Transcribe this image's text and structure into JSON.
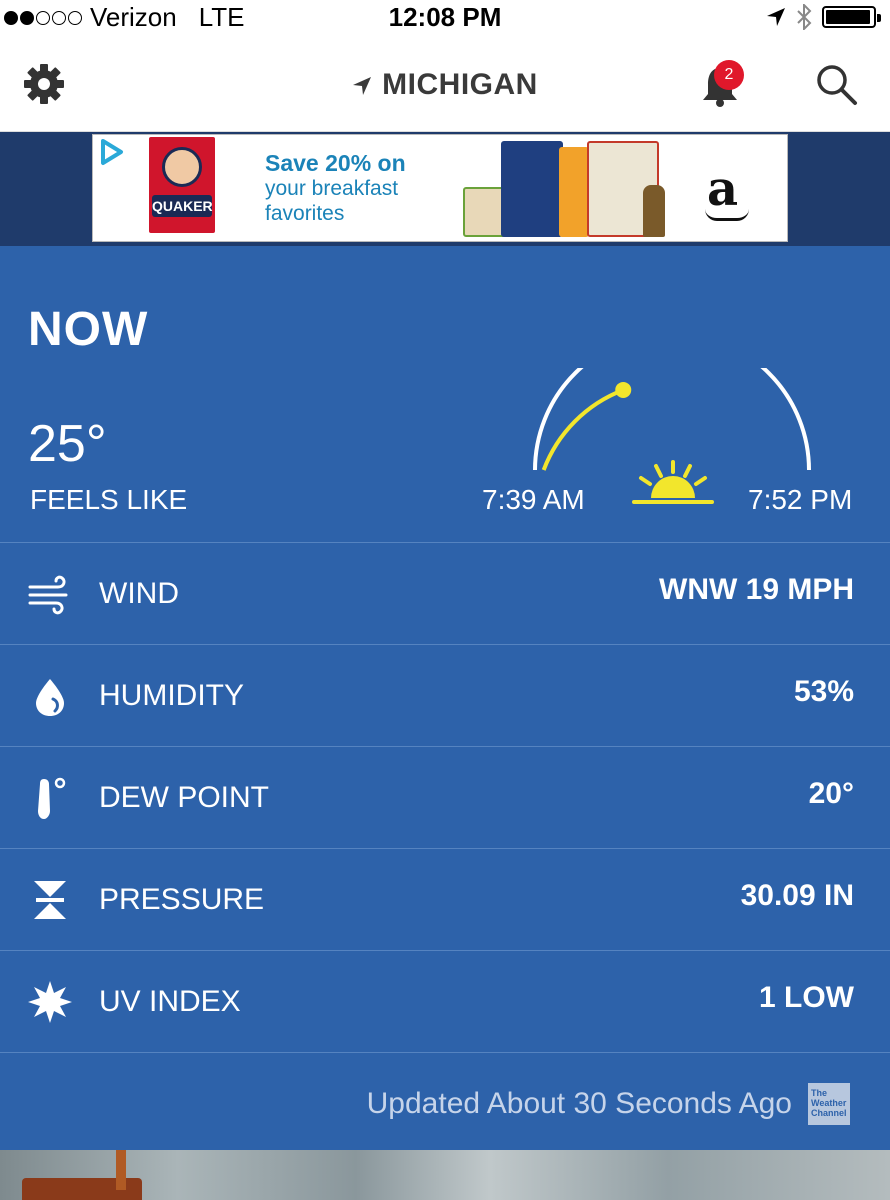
{
  "status_bar": {
    "carrier": "Verizon",
    "network": "LTE",
    "time": "12:08 PM",
    "signal_bars_filled": 2,
    "signal_bars_total": 5,
    "battery_level": 0.95
  },
  "nav": {
    "location": "MICHIGAN",
    "notification_count": "2",
    "icons": [
      "gear-icon",
      "location-arrow-icon",
      "bell-icon",
      "search-icon"
    ]
  },
  "ad": {
    "brand": "QUAKER",
    "headline": "Save 20% on",
    "line2": "your breakfast",
    "line3": "favorites",
    "retailer": "a"
  },
  "weather": {
    "section_title": "NOW",
    "feels_like_temp": "25°",
    "feels_like_label": "FEELS LIKE",
    "sunrise": "7:39 AM",
    "sunset": "7:52 PM",
    "day_progress": 0.35,
    "rows": [
      {
        "icon": "wind-icon",
        "label": "WIND",
        "value": "WNW 19 MPH"
      },
      {
        "icon": "humidity-drop-icon",
        "label": "HUMIDITY",
        "value": "53%"
      },
      {
        "icon": "thermometer-icon",
        "label": "DEW POINT",
        "value": "20°"
      },
      {
        "icon": "pressure-icon",
        "label": "PRESSURE",
        "value": "30.09 IN"
      },
      {
        "icon": "uv-sun-icon",
        "label": "UV INDEX",
        "value": "1 LOW"
      }
    ],
    "updated": "Updated About 30 Seconds Ago",
    "provider_logo": "The Weather Channel"
  },
  "colors": {
    "panel_bg": "#2d62aa",
    "badge": "#e0182b",
    "sun": "#f2e62c",
    "ad_strip": "#1f3b6b"
  }
}
